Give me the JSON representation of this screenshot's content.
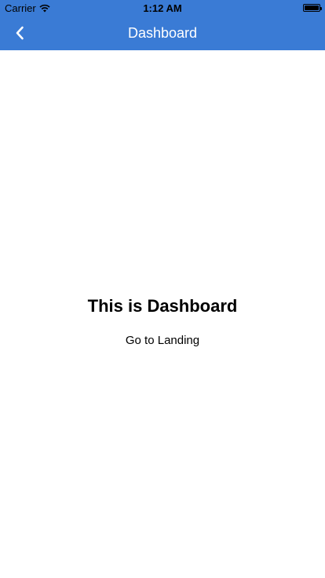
{
  "status_bar": {
    "carrier": "Carrier",
    "time": "1:12 AM",
    "battery_level": 1.0,
    "wifi_icon": "wifi-icon"
  },
  "nav": {
    "title": "Dashboard",
    "back_icon": "chevron-left-icon",
    "background_color": "#3a7bd5"
  },
  "main": {
    "heading": "This is Dashboard",
    "link_label": "Go to Landing"
  }
}
